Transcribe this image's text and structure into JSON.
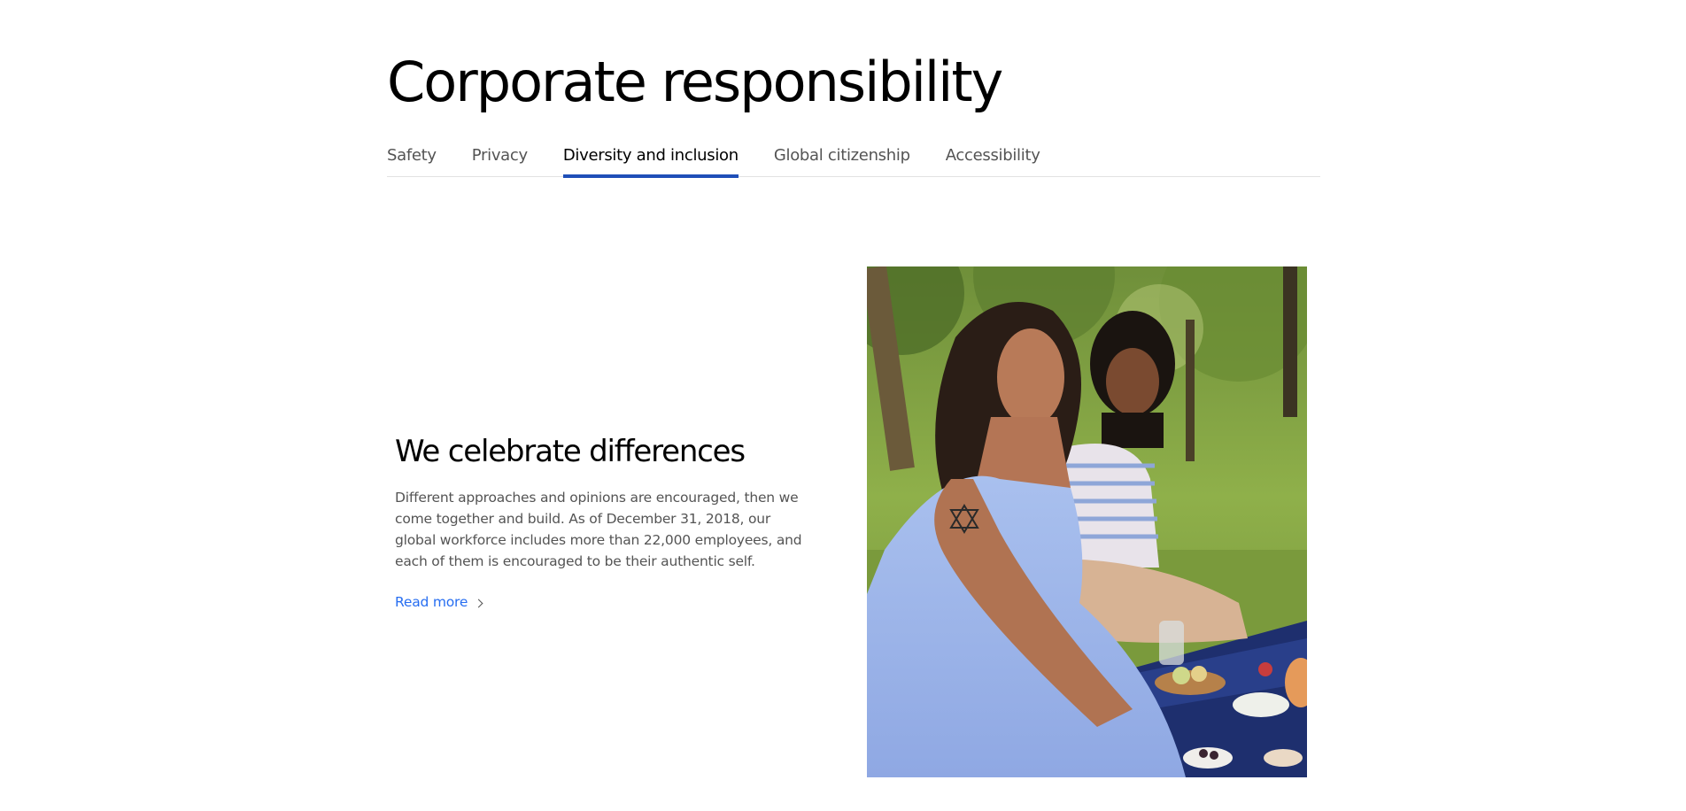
{
  "page": {
    "title": "Corporate responsibility"
  },
  "tabs": [
    {
      "label": "Safety",
      "active": false
    },
    {
      "label": "Privacy",
      "active": false
    },
    {
      "label": "Diversity and inclusion",
      "active": true
    },
    {
      "label": "Global citizenship",
      "active": false
    },
    {
      "label": "Accessibility",
      "active": false
    }
  ],
  "section": {
    "heading": "We celebrate differences",
    "body": "Different approaches and opinions are encouraged, then we come together and build. As of December 31, 2018, our global workforce includes more than 22,000 employees, and each of them is encouraged to be their authentic self.",
    "link_label": "Read more",
    "link_icon": "chevron-right-icon"
  },
  "image": {
    "subject": "two-women-picnic-photo"
  },
  "colors": {
    "accent": "#1f4fb8",
    "link": "#276ef1",
    "body_text": "#545454",
    "tab_divider": "#e2e2e2"
  }
}
